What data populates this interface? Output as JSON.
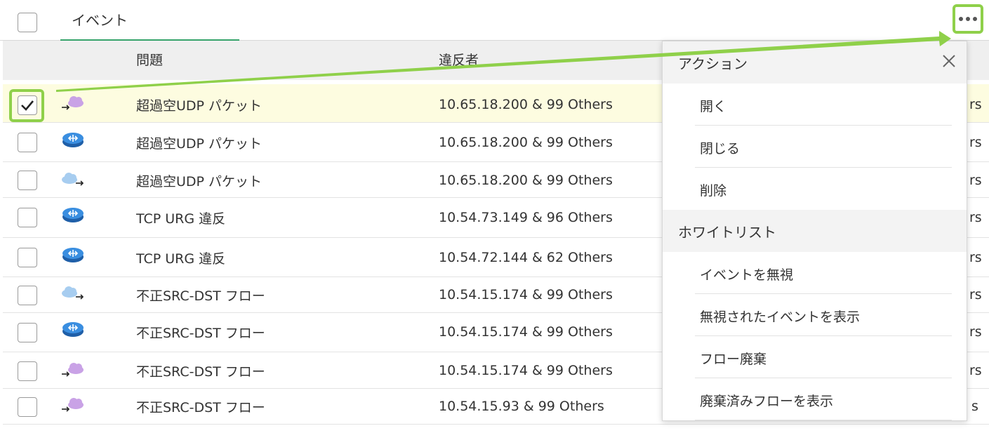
{
  "tab": {
    "label": "イベント"
  },
  "columns": {
    "issue": "問題",
    "offender": "違反者"
  },
  "rows": [
    {
      "issue": "超過空UDP パケット",
      "offender": "10.65.18.200 & 99 Others",
      "tail": "rs",
      "icon": "cloud-purple-icon",
      "checked": true
    },
    {
      "issue": "超過空UDP パケット",
      "offender": "10.65.18.200 & 99 Others",
      "tail": "rs",
      "icon": "router-icon"
    },
    {
      "issue": "超過空UDP パケット",
      "offender": "10.65.18.200 & 99 Others",
      "tail": "rs",
      "icon": "cloud-blue-icon"
    },
    {
      "issue": "TCP URG 違反",
      "offender": "10.54.73.149 & 96 Others",
      "tail": "rs",
      "icon": "router-icon"
    },
    {
      "issue": "TCP URG 違反",
      "offender": "10.54.72.144 & 62 Others",
      "tail": "rs",
      "icon": "router-icon"
    },
    {
      "issue": "不正SRC-DST フロー",
      "offender": "10.54.15.174 & 99 Others",
      "tail": "rs",
      "icon": "cloud-blue-icon"
    },
    {
      "issue": "不正SRC-DST フロー",
      "offender": "10.54.15.174 & 99 Others",
      "tail": "rs",
      "icon": "router-icon"
    },
    {
      "issue": "不正SRC-DST フロー",
      "offender": "10.54.15.174 & 99 Others",
      "tail": "rs",
      "icon": "cloud-purple-icon"
    },
    {
      "issue": "不正SRC-DST フロー",
      "offender": "10.54.15.93 & 99 Others",
      "tail": "s",
      "icon": "cloud-purple-icon"
    }
  ],
  "menu": {
    "actions_header": "アクション",
    "actions": [
      "開く",
      "閉じる",
      "削除"
    ],
    "whitelist_header": "ホワイトリスト",
    "whitelist": [
      "イベントを無視",
      "無視されたイベントを表示",
      "フロー廃棄",
      "廃棄済みフローを表示"
    ]
  },
  "colors": {
    "highlight": "#8fd04a",
    "tab_underline": "#37a36b",
    "selected_row": "#fdfce0",
    "router": "#2f7fd4",
    "cloud_purple": "#c9a2e6",
    "cloud_blue": "#a7cdf0"
  }
}
